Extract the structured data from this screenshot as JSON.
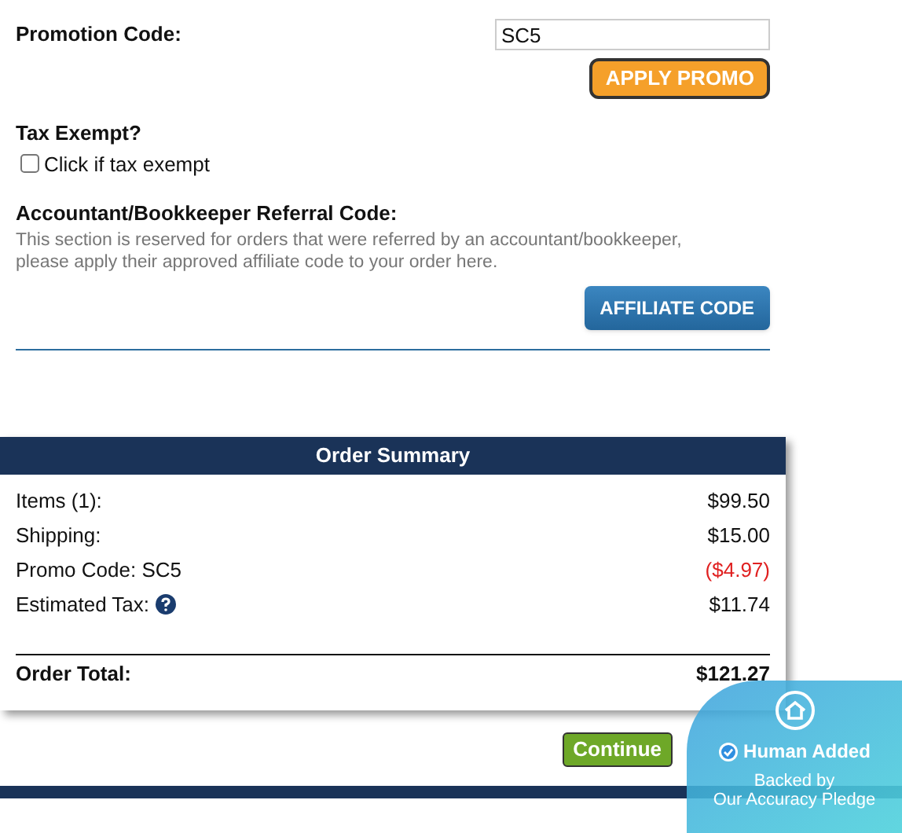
{
  "promotion": {
    "label": "Promotion Code:",
    "value": "SC5",
    "button": "APPLY PROMO"
  },
  "tax_exempt": {
    "heading": "Tax Exempt?",
    "checkbox_label": "Click if tax exempt",
    "checked": false
  },
  "referral": {
    "heading": "Accountant/Bookkeeper Referral Code:",
    "description": "This section is reserved for orders that were referred by an accountant/bookkeeper, please apply their approved affiliate code to your order here.",
    "button": "AFFILIATE CODE"
  },
  "order_summary": {
    "title": "Order Summary",
    "rows": [
      {
        "label": "Items (1):",
        "value": "$99.50",
        "kind": "plain"
      },
      {
        "label": "Shipping:",
        "value": "$15.00",
        "kind": "plain"
      },
      {
        "label": "Promo Code: SC5",
        "value": "($4.97)",
        "kind": "discount"
      },
      {
        "label": "Estimated Tax:",
        "value": "$11.74",
        "kind": "help"
      }
    ],
    "total_label": "Order Total:",
    "total_value": "$121.27"
  },
  "continue_button": "Continue",
  "badge": {
    "title": "Human Added",
    "line_1": "Backed by",
    "line_2": "Our Accuracy Pledge"
  }
}
